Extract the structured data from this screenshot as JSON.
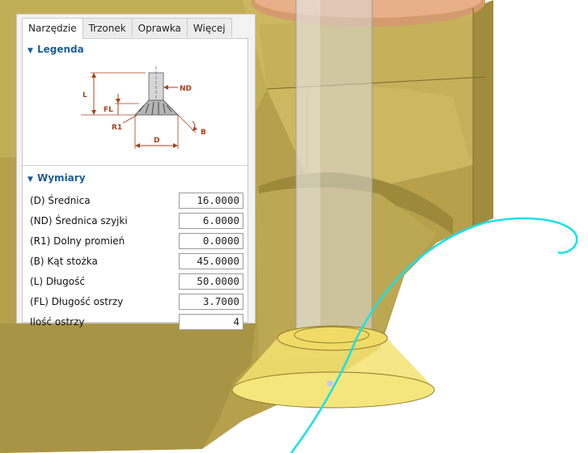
{
  "tabs": [
    {
      "label": "Narzędzie",
      "active": true
    },
    {
      "label": "Trzonek",
      "active": false
    },
    {
      "label": "Oprawka",
      "active": false
    },
    {
      "label": "Więcej",
      "active": false
    }
  ],
  "legend": {
    "title": "Legenda",
    "labels": {
      "L": "L",
      "FL": "FL",
      "ND": "ND",
      "R1": "R1",
      "D": "D",
      "B": "B"
    }
  },
  "dimensions": {
    "title": "Wymiary",
    "rows": [
      {
        "label": "(D) Średnica",
        "value": "16.0000"
      },
      {
        "label": "(ND) Średnica szyjki",
        "value": "6.0000"
      },
      {
        "label": "(R1) Dolny promień",
        "value": "0.0000"
      },
      {
        "label": "(B) Kąt stożka",
        "value": "45.0000"
      },
      {
        "label": "(L) Długość",
        "value": "50.0000"
      },
      {
        "label": "(FL) Długość ostrzy",
        "value": "3.7000"
      },
      {
        "label": "Ilość ostrzy",
        "value": "4"
      }
    ]
  },
  "colors": {
    "accent": "#1c5d99",
    "diagram_dim": "#a8411d",
    "part": "#b7a24f",
    "part_dark": "#8f7d35",
    "toolpath": "#19e0ea",
    "cutter": "#f3e271"
  }
}
